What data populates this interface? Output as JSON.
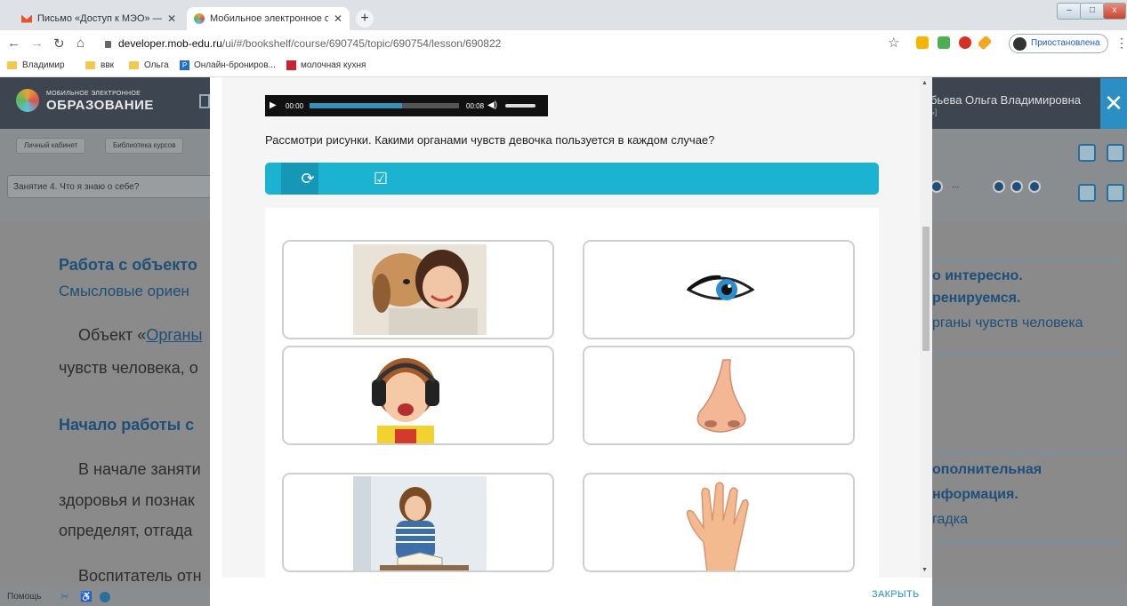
{
  "browser": {
    "tabs": [
      {
        "title": "Письмо «Доступ к МЭО» — Ро",
        "active": false
      },
      {
        "title": "Мобильное электронное обра",
        "active": true
      }
    ],
    "new_tab": "+",
    "url_host": "developer.mob-edu.ru",
    "url_path": "/ui/#/bookshelf/course/690745/topic/690754/lesson/690822",
    "profile_label": "Приостановлена",
    "window_controls": {
      "minimize": "–",
      "maximize": "□",
      "close": "x"
    },
    "bookmarks": [
      {
        "label": "Владимир",
        "icon": "folder-icon"
      },
      {
        "label": "ввк",
        "icon": "folder-icon"
      },
      {
        "label": "Ольга",
        "icon": "folder-icon"
      },
      {
        "label": "Онлайн-брониров...",
        "icon": "p-site-icon"
      },
      {
        "label": "молочная кухня",
        "icon": "site-icon"
      }
    ]
  },
  "site": {
    "logo_small": "МОБИЛЬНОЕ ЭЛЕКТРОННОЕ",
    "logo_big": "ОБРАЗОВАНИЕ",
    "user_name": "бьева Ольга Владимировна",
    "user_sub": "ь]",
    "breadcrumbs": [
      "Личный кабинет",
      "Библиотека курсов"
    ],
    "lesson_title": "Занятие 4. Что я знаю о себе?",
    "pager_partial": "...",
    "content": {
      "h1_left": "Работа с объекто",
      "h1_left_sub": "Смысловые ориен",
      "p1_prefix": "Объект «",
      "p1_link": "Органы",
      "p1_line2": "чувств человека, о",
      "h2_left": "Начало работы с",
      "p2_line1": "В начале заняти",
      "p2_line2": "здоровья и познак",
      "p2_line3": "определят, отгада",
      "p3_line1": "Воспитатель отн",
      "right1_line1": "о интересно.",
      "right1_line2": "ренируемся.",
      "right1_line3": "рганы чувств человека",
      "right2_line1": "ополнительная",
      "right2_line2": "нформация.",
      "right2_line3": "гадка"
    },
    "help_label": "Помощь"
  },
  "modal": {
    "audio": {
      "current": "00:00",
      "duration": "00:08",
      "progress": 0.62
    },
    "question": "Рассмотри рисунки. Какими органами чувств девочка пользуется в каждом случае?",
    "actions": [
      {
        "name": "reset",
        "icon": "refresh-icon"
      },
      {
        "name": "check",
        "icon": "check-box-icon"
      }
    ],
    "cards": [
      {
        "col": "left",
        "row": 1,
        "image": "girl-with-dog"
      },
      {
        "col": "right",
        "row": 1,
        "image": "eye"
      },
      {
        "col": "left",
        "row": 2,
        "image": "girl-with-headphones"
      },
      {
        "col": "right",
        "row": 2,
        "image": "nose"
      },
      {
        "col": "left",
        "row": 3,
        "image": "girl-reading"
      },
      {
        "col": "right",
        "row": 3,
        "image": "hand"
      }
    ],
    "close_label": "ЗАКРЫТЬ"
  }
}
